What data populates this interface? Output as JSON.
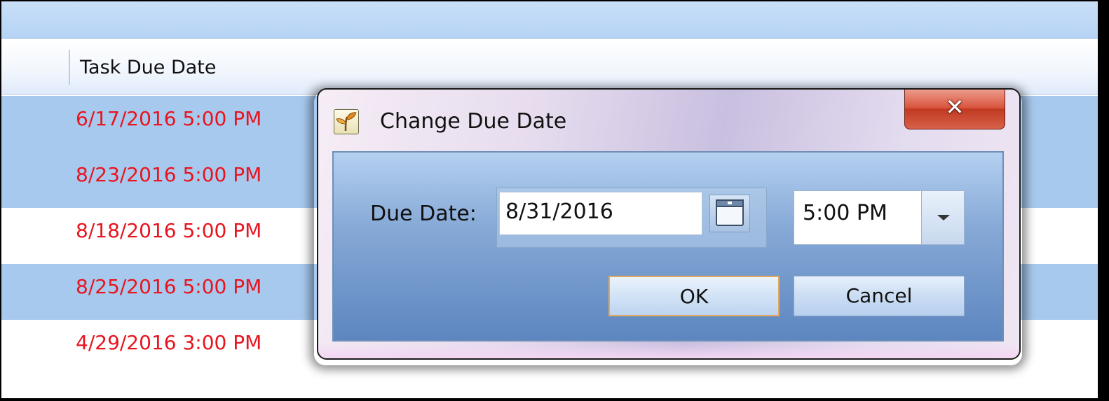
{
  "grid": {
    "column_header": "Task Due Date",
    "rows": [
      {
        "due": "6/17/2016 5:00 PM",
        "selected": true
      },
      {
        "due": "8/23/2016 5:00 PM",
        "selected": true
      },
      {
        "due": "8/18/2016 5:00 PM",
        "selected": false
      },
      {
        "due": "8/25/2016 5:00 PM",
        "selected": true
      },
      {
        "due": "4/29/2016 3:00 PM",
        "selected": false
      }
    ],
    "overdue_color": "#e8141e",
    "selection_color": "#a8c9ee"
  },
  "dialog": {
    "title": "Change Due Date",
    "icon": "app-sprout-icon",
    "close_glyph": "✕",
    "due_date_label": "Due Date:",
    "date_value": "8/31/2016",
    "time_value": "5:00 PM",
    "ok_label": "OK",
    "cancel_label": "Cancel"
  }
}
